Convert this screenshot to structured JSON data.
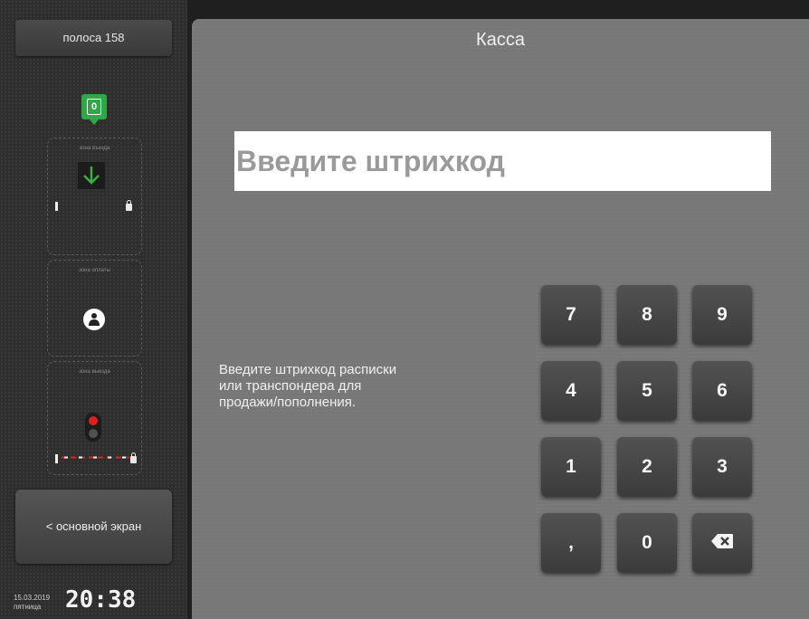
{
  "sidebar": {
    "lane_label": "полоса 158",
    "counter": "0",
    "zones": [
      {
        "label": "зона въезда"
      },
      {
        "label": "зона оплаты"
      },
      {
        "label": "зона выезда"
      }
    ],
    "back_label": "< основной экран",
    "date": "15.03.2019",
    "weekday": "пятница",
    "time": "20:38"
  },
  "main": {
    "title": "Касса",
    "barcode_placeholder": "Введите штрихкод",
    "hint_lines": [
      "Введите штрихкод расписки",
      "или транспондера для",
      "продажи/пополнения."
    ]
  },
  "keypad": {
    "keys": [
      "7",
      "8",
      "9",
      "4",
      "5",
      "6",
      "1",
      "2",
      "3",
      ",",
      "0",
      "backspace-icon"
    ]
  },
  "colors": {
    "counter_green": "#2fa84a",
    "arrow_green": "#3cb043",
    "traffic_red": "#e02020",
    "panel_gray": "#7a7a7a"
  },
  "icons": [
    "down-arrow-icon",
    "lock-icon",
    "person-icon",
    "traffic-light-icon",
    "barrier-icon",
    "backspace-icon"
  ]
}
